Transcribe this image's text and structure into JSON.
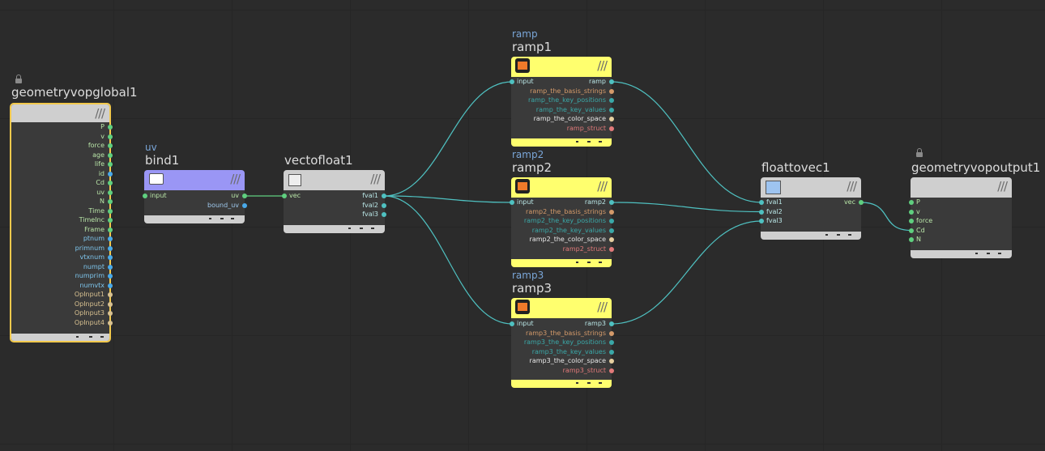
{
  "colors": {
    "background": "#2b2b2b",
    "wire": "#4fc1c1",
    "port_green": "#5fcf7f",
    "port_blue": "#49a9e9",
    "port_teal": "#3aa8a8",
    "port_orange": "#d49a6a",
    "port_pink": "#e27a7a",
    "port_tan": "#d8c190",
    "ramp_yellow": "#ffff6e",
    "bind_purple": "#9a96f5",
    "gray_header": "#cfcfcf"
  },
  "nodes": {
    "geometryvopglobal1": {
      "name": "geometryvopglobal1",
      "outputs": [
        "P",
        "v",
        "force",
        "age",
        "life",
        "id",
        "Cd",
        "uv",
        "N",
        "Time",
        "TimeInc",
        "Frame",
        "ptnum",
        "primnum",
        "vtxnum",
        "numpt",
        "numprim",
        "numvtx",
        "OpInput1",
        "OpInput2",
        "OpInput3",
        "OpInput4"
      ]
    },
    "bind1": {
      "type": "uv",
      "name": "bind1",
      "inputs": [
        "input"
      ],
      "outputs": [
        "uv",
        "bound_uv"
      ]
    },
    "vectofloat1": {
      "name": "vectofloat1",
      "inputs": [
        "vec"
      ],
      "outputs": [
        "fval1",
        "fval2",
        "fval3"
      ]
    },
    "ramp1": {
      "type": "ramp",
      "name": "ramp1",
      "inputs": [
        "input"
      ],
      "outputs": [
        "ramp",
        "ramp_the_basis_strings",
        "ramp_the_key_positions",
        "ramp_the_key_values",
        "ramp_the_color_space",
        "ramp_struct"
      ]
    },
    "ramp2": {
      "type": "ramp2",
      "name": "ramp2",
      "inputs": [
        "input"
      ],
      "outputs": [
        "ramp2",
        "ramp2_the_basis_strings",
        "ramp2_the_key_positions",
        "ramp2_the_key_values",
        "ramp2_the_color_space",
        "ramp2_struct"
      ]
    },
    "ramp3": {
      "type": "ramp3",
      "name": "ramp3",
      "inputs": [
        "input"
      ],
      "outputs": [
        "ramp3",
        "ramp3_the_basis_strings",
        "ramp3_the_key_positions",
        "ramp3_the_key_values",
        "ramp3_the_color_space",
        "ramp3_struct"
      ]
    },
    "floattovec1": {
      "name": "floattovec1",
      "inputs": [
        "fval1",
        "fval2",
        "fval3"
      ],
      "outputs": [
        "vec"
      ]
    },
    "geometryvopoutput1": {
      "name": "geometryvopoutput1",
      "inputs": [
        "P",
        "v",
        "force",
        "Cd",
        "N"
      ]
    }
  }
}
